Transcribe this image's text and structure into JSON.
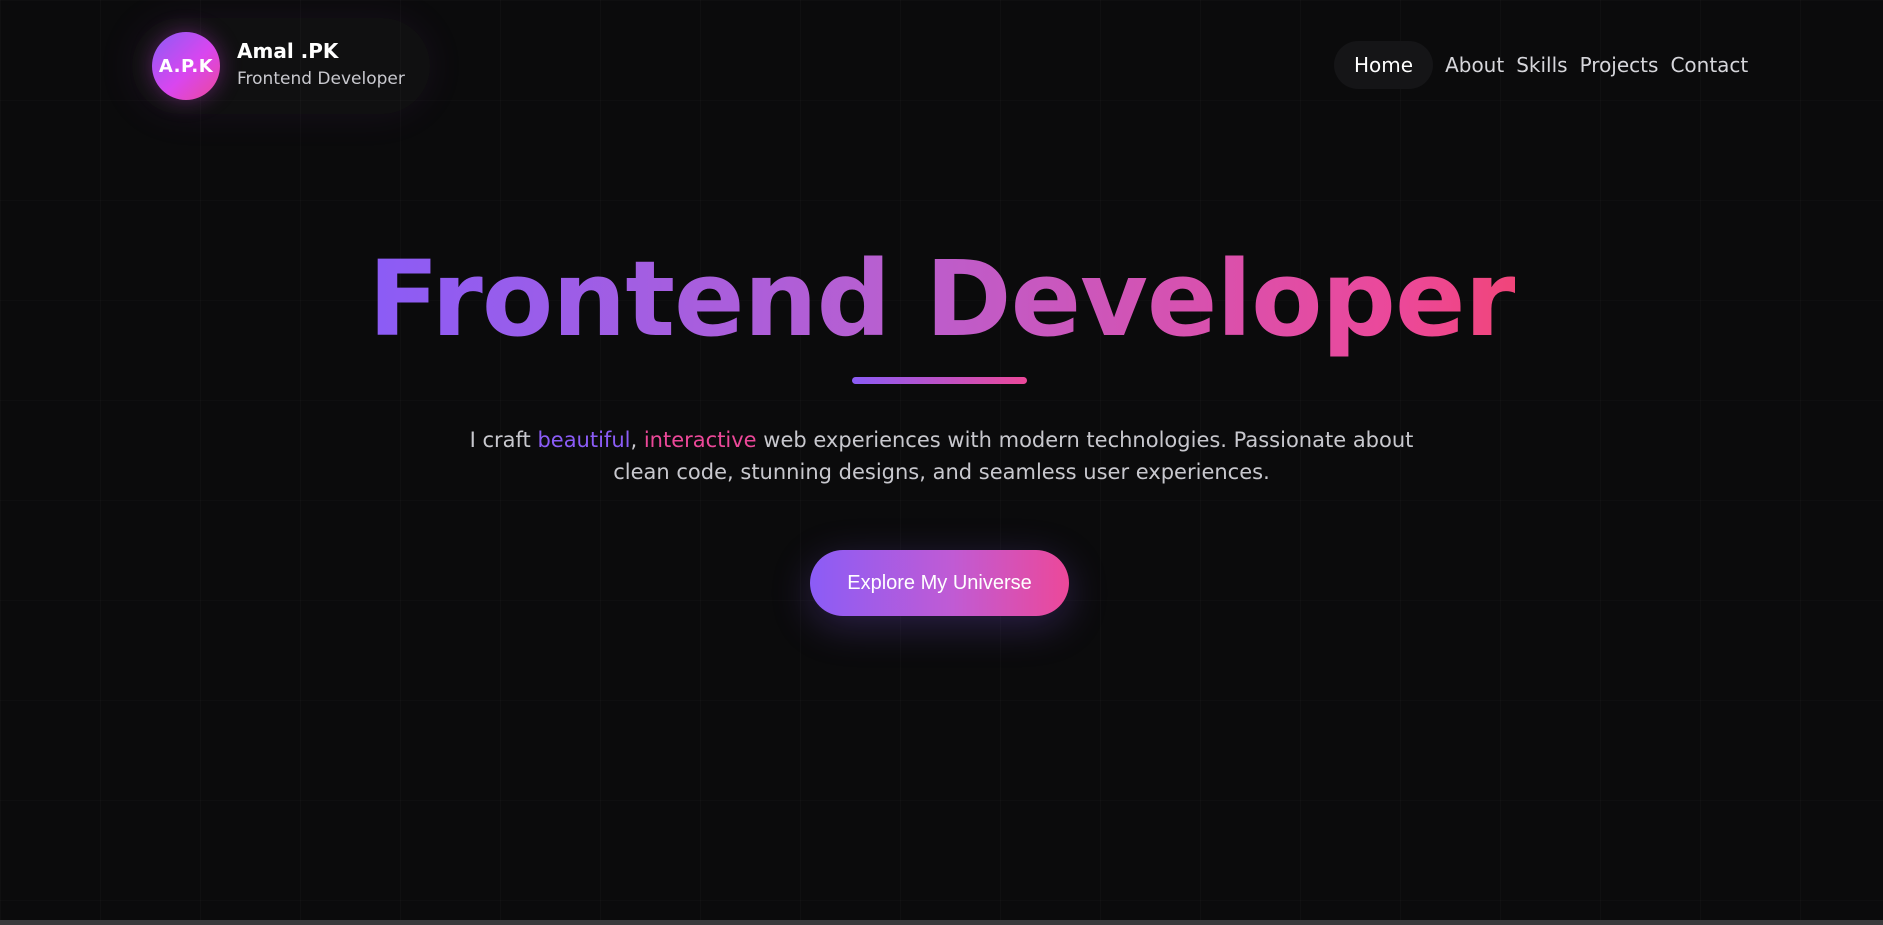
{
  "brand": {
    "logo_text": "A.P.K",
    "name": "Amal .PK",
    "role": "Frontend Developer"
  },
  "nav": {
    "items": [
      {
        "label": "Home",
        "active": true
      },
      {
        "label": "About",
        "active": false
      },
      {
        "label": "Skills",
        "active": false
      },
      {
        "label": "Projects",
        "active": false
      },
      {
        "label": "Contact",
        "active": false
      }
    ]
  },
  "hero": {
    "title": "Frontend Developer",
    "tagline": {
      "prefix": "I craft ",
      "highlight1": "beautiful",
      "sep": ", ",
      "highlight2": "interactive",
      "line1_rest": " web experiences with modern technologies. Passionate about",
      "line2": "clean code, stunning designs, and seamless user experiences."
    },
    "cta_label": "Explore My Universe"
  },
  "colors": {
    "background": "#0b0b0c",
    "accent_purple": "#8b5cf6",
    "accent_pink": "#ec4899"
  }
}
